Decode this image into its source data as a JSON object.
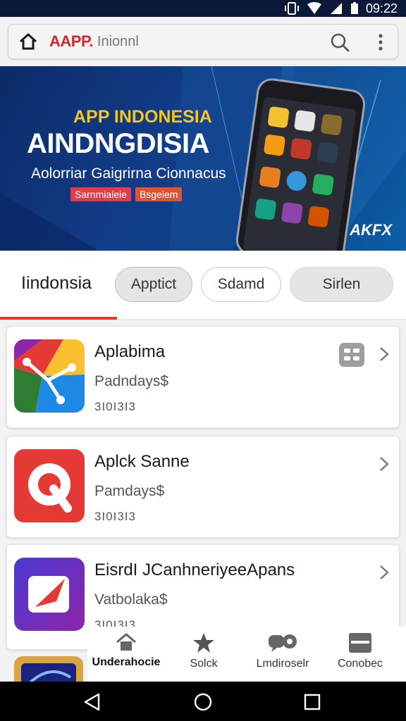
{
  "status_bar": {
    "time": "09:22"
  },
  "search": {
    "brand_accent": "AAPP.",
    "placeholder_text": "Inionnl"
  },
  "banner": {
    "kicker": "APP INDONESIA",
    "headline": "AINDNGDISIA",
    "subtitle": "Aolorriar Gaigrirna Cionnacus",
    "tags": [
      "Sarnmialeie",
      "Bsgeiem"
    ],
    "logo_text": "AKFX"
  },
  "tabs": {
    "active": "Iindonsia",
    "chips": [
      "Apptict",
      "Sdamd",
      "Sirlen"
    ]
  },
  "apps": [
    {
      "name": "Aplabima",
      "subtitle": "Padndays$",
      "meta": "3I0I3I3"
    },
    {
      "name": "Aplck Sanne",
      "subtitle": "Pamdays$",
      "meta": "3I0I3I3"
    },
    {
      "name": "EisrdI JCanhneriyeeApans",
      "subtitle": "Vatbolaka$",
      "meta": "3I0I3I3"
    }
  ],
  "bottom_nav": {
    "items": [
      {
        "label": "Underahocie",
        "icon": "home-icon",
        "active": true
      },
      {
        "label": "Solck",
        "icon": "star-icon",
        "active": false
      },
      {
        "label": "Lmdiroselr",
        "icon": "chat-icon",
        "active": false
      },
      {
        "label": "Conobec",
        "icon": "menu-icon",
        "active": false
      }
    ]
  },
  "colors": {
    "accent_red": "#e23b30",
    "status_bar": "#0b1838",
    "banner_blue": "#123c87",
    "banner_yellow": "#f3c623"
  }
}
